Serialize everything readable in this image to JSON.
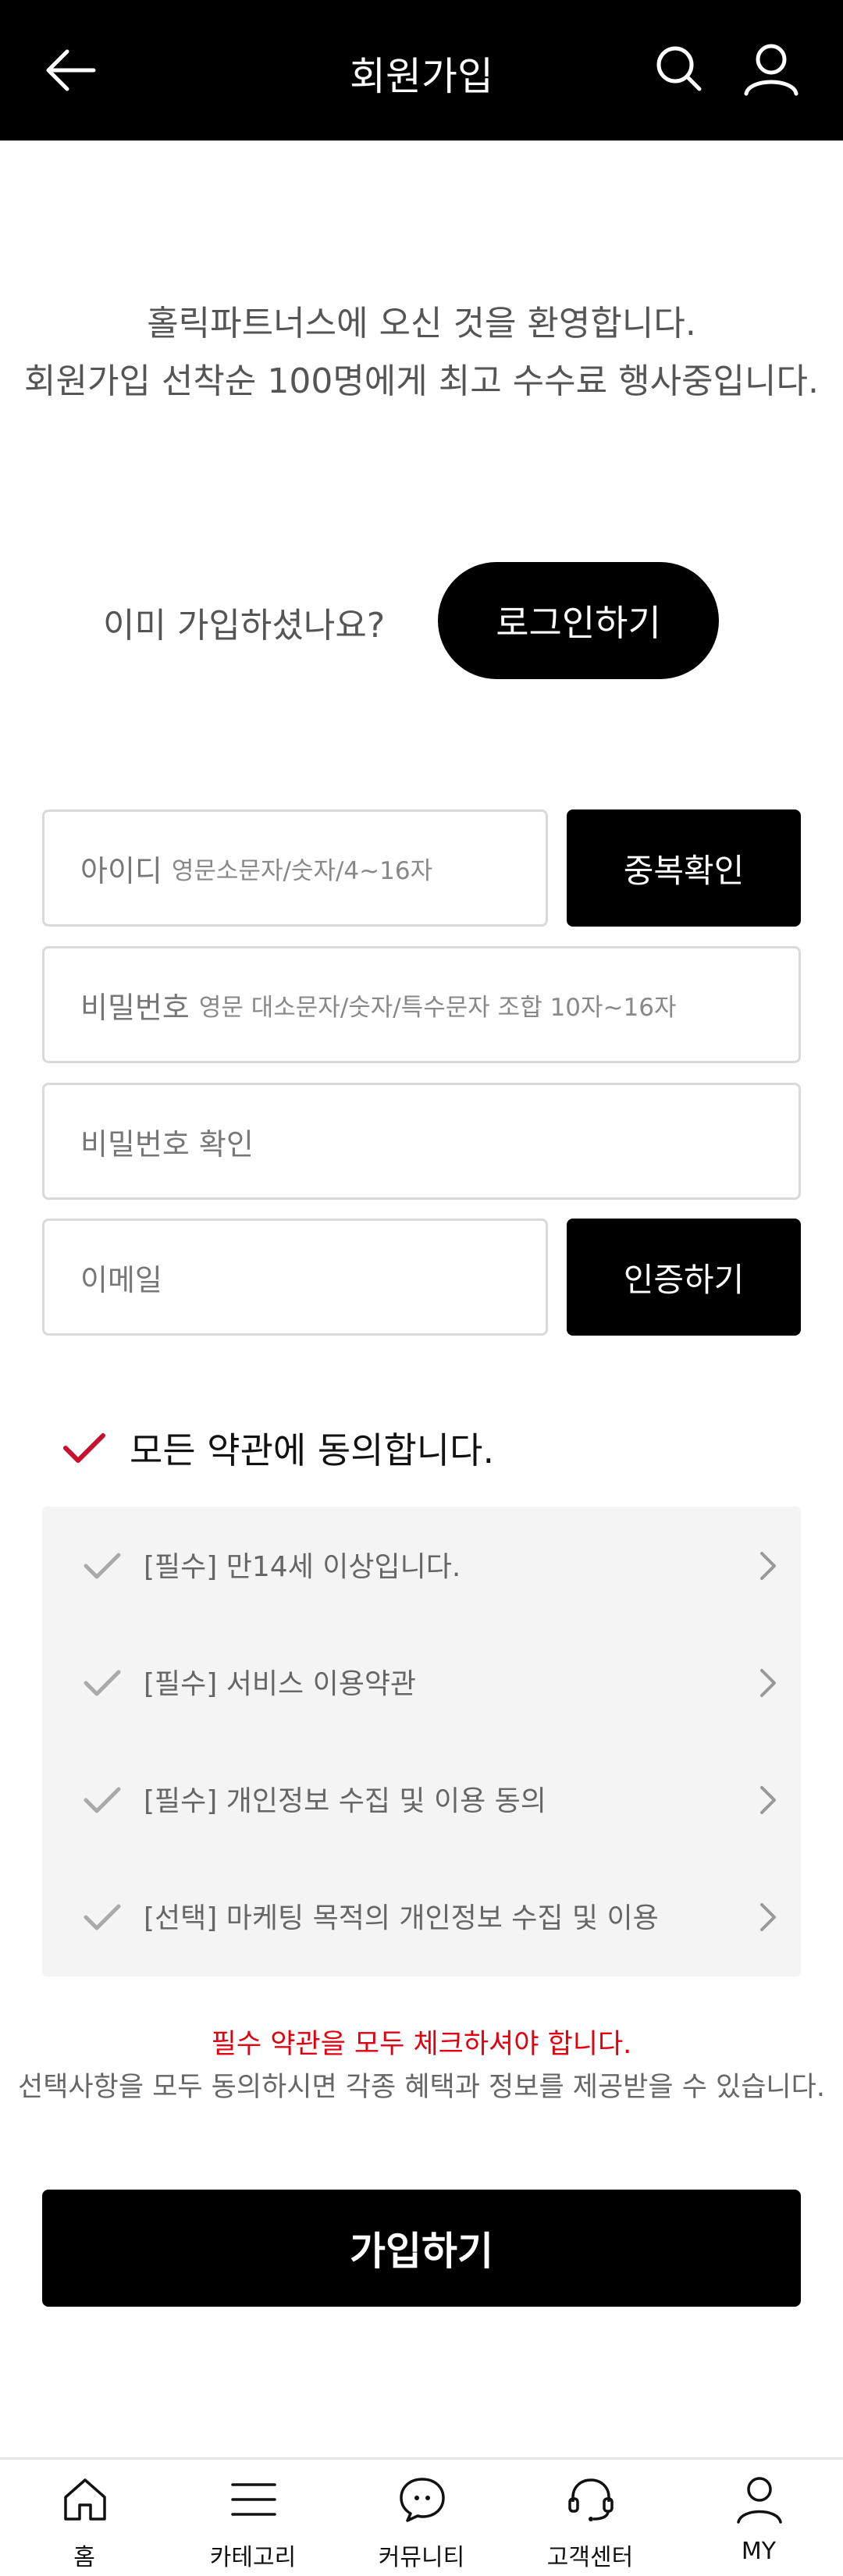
{
  "header": {
    "title": "회원가입",
    "back_icon": "back-arrow-icon",
    "search_icon": "search-icon",
    "user_icon": "user-icon"
  },
  "welcome": {
    "line1": "홀릭파트너스에 오신 것을 환영합니다.",
    "line2": "회원가입 선착순 100명에게 최고 수수료 행사중입니다."
  },
  "login": {
    "question": "이미 가입하셨나요?",
    "button": "로그인하기"
  },
  "form": {
    "id_label": "아이디",
    "id_hint": "영문소문자/숫자/4~16자",
    "id_check_button": "중복확인",
    "password_label": "비밀번호",
    "password_hint": "영문 대소문자/숫자/특수문자 조합 10자~16자",
    "password_confirm_label": "비밀번호 확인",
    "email_label": "이메일",
    "email_verify_button": "인증하기"
  },
  "agreement": {
    "all_label": "모든 약관에 동의합니다.",
    "items": [
      {
        "label": "[필수] 만14세 이상입니다."
      },
      {
        "label": "[필수] 서비스 이용약관"
      },
      {
        "label": "[필수] 개인정보 수집 및 이용 동의"
      },
      {
        "label": "[선택] 마케팅 목적의 개인정보 수집 및 이용"
      }
    ]
  },
  "notice": {
    "required": "필수 약관을 모두 체크하셔야 합니다.",
    "optional": "선택사항을 모두 동의하시면 각종 혜택과 정보를 제공받을 수 있습니다."
  },
  "join_button": "가입하기",
  "bottom_nav": {
    "items": [
      {
        "label": "홈",
        "icon": "home-icon"
      },
      {
        "label": "카테고리",
        "icon": "menu-icon"
      },
      {
        "label": "커뮤니티",
        "icon": "chat-icon"
      },
      {
        "label": "고객센터",
        "icon": "headset-icon"
      },
      {
        "label": "MY",
        "icon": "user-icon"
      }
    ]
  },
  "colors": {
    "header_bg": "#000000",
    "accent_red": "#e0000f",
    "check_red": "#c8102e",
    "terms_bg": "#f4f4f4"
  }
}
